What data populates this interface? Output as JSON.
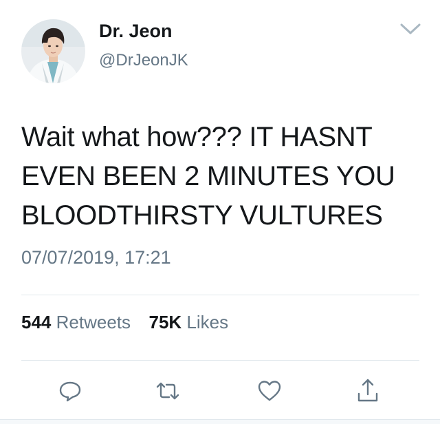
{
  "user": {
    "display_name": "Dr. Jeon",
    "handle": "@DrJeonJK"
  },
  "tweet": {
    "lines": [
      "Wait what how??? IT HASNT",
      "EVEN BEEN 2 MINUTES YOU",
      "BLOODTHIRSTY VULTURES"
    ],
    "timestamp": "07/07/2019, 17:21"
  },
  "stats": {
    "retweets_count": "544",
    "retweets_label": "Retweets",
    "likes_count": "75K",
    "likes_label": "Likes"
  },
  "icons": {
    "menu": "chevron-down-icon",
    "reply": "reply-bubble-icon",
    "retweet": "retweet-icon",
    "like": "heart-icon",
    "share": "share-icon"
  },
  "colors": {
    "text": "#14171a",
    "secondary": "#657786",
    "divider": "#e1e8ed"
  }
}
